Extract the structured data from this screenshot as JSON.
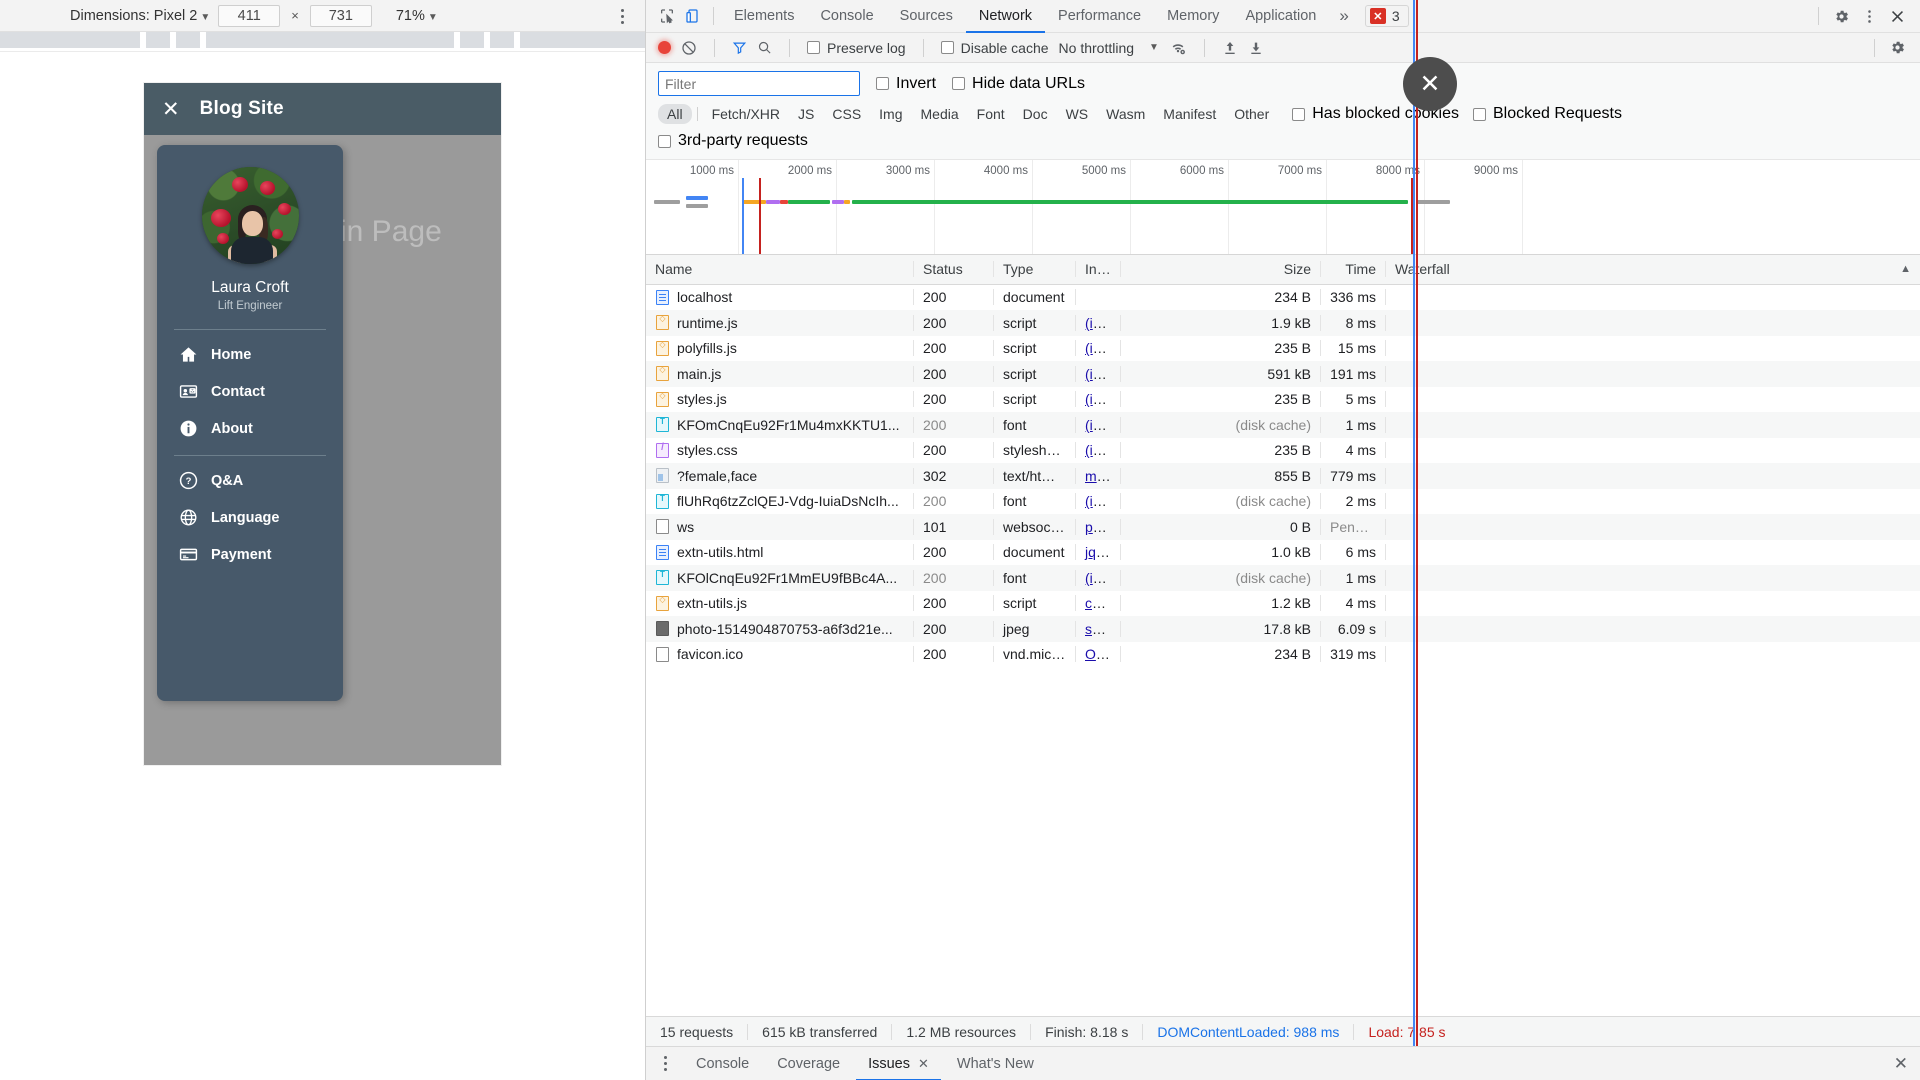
{
  "device_toolbar": {
    "dimensions_label": "Dimensions: Pixel 2",
    "width_value": "411",
    "x_separator": "×",
    "height_value": "731",
    "zoom_value": "71%",
    "caret": "▼",
    "kebab_name": "more-options"
  },
  "phone": {
    "appbar": {
      "close_icon": "✕",
      "title": "Blog Site"
    },
    "main_page_text": "in Page",
    "profile": {
      "name": "Laura Croft",
      "role": "Lift Engineer"
    },
    "nav_primary": [
      {
        "label": "Home",
        "icon": "home-icon"
      },
      {
        "label": "Contact",
        "icon": "contact-card-icon"
      },
      {
        "label": "About",
        "icon": "info-icon"
      }
    ],
    "nav_secondary": [
      {
        "label": "Q&A",
        "icon": "help-circle-icon"
      },
      {
        "label": "Language",
        "icon": "globe-icon"
      },
      {
        "label": "Payment",
        "icon": "credit-card-icon"
      }
    ]
  },
  "devtools": {
    "tabs": [
      {
        "label": "Elements",
        "active": false
      },
      {
        "label": "Console",
        "active": false
      },
      {
        "label": "Sources",
        "active": false
      },
      {
        "label": "Network",
        "active": true
      },
      {
        "label": "Performance",
        "active": false
      },
      {
        "label": "Memory",
        "active": false
      },
      {
        "label": "Application",
        "active": false
      }
    ],
    "more_tabs": "»",
    "issues": {
      "count": "3",
      "icon_glyph": "✕"
    },
    "settings_icon": "gear-icon",
    "kebab_icon": "more-vertical-icon",
    "close_icon": "✕",
    "controls": {
      "record_label": "record-button",
      "clear_label": "clear-button",
      "filter_toggle": "filter-funnel-icon",
      "search_toggle": "search-icon",
      "preserve_log": "Preserve log",
      "disable_cache": "Disable cache",
      "throttling": "No throttling",
      "throttle_caret": "▼",
      "wifi_icon": "network-conditions-icon",
      "import_icon": "import-har-icon",
      "export_icon": "export-har-icon",
      "right_settings_icon": "gear-icon"
    },
    "filter": {
      "placeholder": "Filter",
      "value": "",
      "invert": "Invert",
      "hide_data_urls": "Hide data URLs",
      "types": [
        "All",
        "Fetch/XHR",
        "JS",
        "CSS",
        "Img",
        "Media",
        "Font",
        "Doc",
        "WS",
        "Wasm",
        "Manifest",
        "Other"
      ],
      "active_type": "All",
      "has_blocked_cookies": "Has blocked cookies",
      "blocked_requests": "Blocked Requests",
      "third_party_requests": "3rd-party requests"
    },
    "overview_ticks": [
      "1000 ms",
      "2000 ms",
      "3000 ms",
      "4000 ms",
      "5000 ms",
      "6000 ms",
      "7000 ms",
      "8000 ms",
      "9000 ms"
    ],
    "table": {
      "columns": [
        "Name",
        "Status",
        "Type",
        "Init...",
        "Size",
        "Time",
        "Waterfall"
      ],
      "sort_arrow": "▲",
      "rows": [
        {
          "name": "localhost",
          "icon": "document-icon",
          "status": "200",
          "type": "document",
          "initiator": "",
          "size": "234 B",
          "time": "336 ms",
          "dim": false
        },
        {
          "name": "runtime.js",
          "icon": "script-icon",
          "status": "200",
          "type": "script",
          "initiator": "(in...",
          "size": "1.9 kB",
          "time": "8 ms",
          "dim": false
        },
        {
          "name": "polyfills.js",
          "icon": "script-icon",
          "status": "200",
          "type": "script",
          "initiator": "(in...",
          "size": "235 B",
          "time": "15 ms",
          "dim": false
        },
        {
          "name": "main.js",
          "icon": "script-icon",
          "status": "200",
          "type": "script",
          "initiator": "(in...",
          "size": "591 kB",
          "time": "191 ms",
          "dim": false
        },
        {
          "name": "styles.js",
          "icon": "script-icon",
          "status": "200",
          "type": "script",
          "initiator": "(in...",
          "size": "235 B",
          "time": "5 ms",
          "dim": false
        },
        {
          "name": "KFOmCnqEu92Fr1Mu4mxKKTU1...",
          "icon": "font-icon",
          "status": "200",
          "type": "font",
          "initiator": "(in...",
          "size": "(disk cache)",
          "time": "1 ms",
          "dim": true
        },
        {
          "name": "styles.css",
          "icon": "stylesheet-icon",
          "status": "200",
          "type": "stylesheet",
          "initiator": "(in...",
          "size": "235 B",
          "time": "4 ms",
          "dim": false
        },
        {
          "name": "?female,face",
          "icon": "html-icon",
          "status": "302",
          "type": "text/html...",
          "initiator": "ma...",
          "size": "855 B",
          "time": "779 ms",
          "dim": false
        },
        {
          "name": "flUhRq6tzZclQEJ-Vdg-IuiaDsNcIh...",
          "icon": "font-icon",
          "status": "200",
          "type": "font",
          "initiator": "(in...",
          "size": "(disk cache)",
          "time": "2 ms",
          "dim": true
        },
        {
          "name": "ws",
          "icon": "other-icon",
          "status": "101",
          "type": "websocket",
          "initiator": "pol...",
          "size": "0 B",
          "time": "Pendi...",
          "dim": false
        },
        {
          "name": "extn-utils.html",
          "icon": "document-icon",
          "status": "200",
          "type": "document",
          "initiator": "jqu...",
          "size": "1.0 kB",
          "time": "6 ms",
          "dim": false
        },
        {
          "name": "KFOlCnqEu92Fr1MmEU9fBBc4A...",
          "icon": "font-icon",
          "status": "200",
          "type": "font",
          "initiator": "(in...",
          "size": "(disk cache)",
          "time": "1 ms",
          "dim": true
        },
        {
          "name": "extn-utils.js",
          "icon": "script-icon",
          "status": "200",
          "type": "script",
          "initiator": "chr...",
          "size": "1.2 kB",
          "time": "4 ms",
          "dim": false
        },
        {
          "name": "photo-1514904870753-a6f3d21e...",
          "icon": "image-icon",
          "status": "200",
          "type": "jpeg",
          "initiator": "so...",
          "size": "17.8 kB",
          "time": "6.09 s",
          "dim": false
        },
        {
          "name": "favicon.ico",
          "icon": "other-icon",
          "status": "200",
          "type": "vnd.micr...",
          "initiator": "Ot...",
          "size": "234 B",
          "time": "319 ms",
          "dim": false
        }
      ]
    },
    "summary": {
      "requests": "15 requests",
      "transferred": "615 kB transferred",
      "resources": "1.2 MB resources",
      "finish": "Finish: 8.18 s",
      "dom_content_loaded": "DOMContentLoaded: 988 ms",
      "load": "Load: 7.85 s"
    },
    "drawer": {
      "kebab": "more-vertical-icon",
      "tabs": [
        {
          "label": "Console",
          "active": false,
          "closable": false
        },
        {
          "label": "Coverage",
          "active": false,
          "closable": false
        },
        {
          "label": "Issues",
          "active": true,
          "closable": true
        },
        {
          "label": "What's New",
          "active": false,
          "closable": false
        }
      ],
      "close_glyph": "✕",
      "drawer_close": "✕"
    }
  },
  "click_overlay": {
    "glyph": "✕",
    "name": "click-indicator"
  },
  "colors": {
    "accent_blue": "#1a73e8",
    "record_red": "#e8443a",
    "error_red": "#d93025",
    "drawer_bg": "#47596a",
    "appbar_bg": "#4a5c66",
    "waterfall_green": "#24b14b"
  }
}
